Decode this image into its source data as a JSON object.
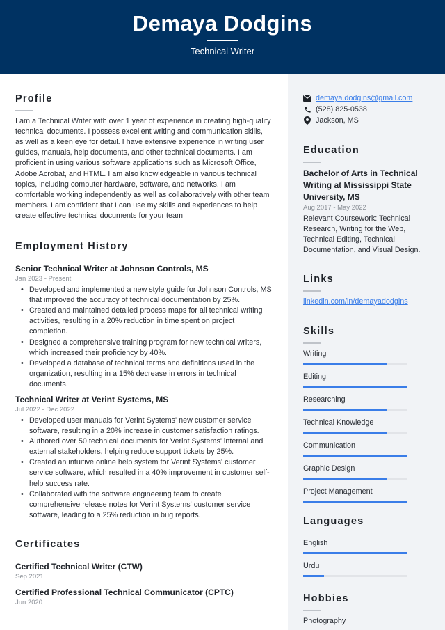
{
  "header": {
    "name": "Demaya Dodgins",
    "title": "Technical Writer"
  },
  "profile": {
    "heading": "Profile",
    "text": "I am a Technical Writer with over 1 year of experience in creating high-quality technical documents. I possess excellent writing and communication skills, as well as a keen eye for detail. I have extensive experience in writing user guides, manuals, help documents, and other technical documents. I am proficient in using various software applications such as Microsoft Office, Adobe Acrobat, and HTML. I am also knowledgeable in various technical topics, including computer hardware, software, and networks. I am comfortable working independently as well as collaboratively with other team members. I am confident that I can use my skills and experiences to help create effective technical documents for your team."
  },
  "employment": {
    "heading": "Employment History",
    "jobs": [
      {
        "title": "Senior Technical Writer at Johnson Controls, MS",
        "dates": "Jan 2023 - Present",
        "bullets": [
          "Developed and implemented a new style guide for Johnson Controls, MS that improved the accuracy of technical documentation by 25%.",
          "Created and maintained detailed process maps for all technical writing activities, resulting in a 20% reduction in time spent on project completion.",
          "Designed a comprehensive training program for new technical writers, which increased their proficiency by 40%.",
          "Developed a database of technical terms and definitions used in the organization, resulting in a 15% decrease in errors in technical documents."
        ]
      },
      {
        "title": "Technical Writer at Verint Systems, MS",
        "dates": "Jul 2022 - Dec 2022",
        "bullets": [
          "Developed user manuals for Verint Systems' new customer service software, resulting in a 20% increase in customer satisfaction ratings.",
          "Authored over 50 technical documents for Verint Systems' internal and external stakeholders, helping reduce support tickets by 25%.",
          "Created an intuitive online help system for Verint Systems' customer service software, which resulted in a 40% improvement in customer self-help success rate.",
          "Collaborated with the software engineering team to create comprehensive release notes for Verint Systems' customer service software, leading to a 25% reduction in bug reports."
        ]
      }
    ]
  },
  "certificates": {
    "heading": "Certificates",
    "items": [
      {
        "name": "Certified Technical Writer (CTW)",
        "date": "Sep 2021"
      },
      {
        "name": "Certified Professional Technical Communicator (CPTC)",
        "date": "Jun 2020"
      }
    ]
  },
  "contact": {
    "email": "demaya.dodgins@gmail.com",
    "phone": "(528) 825-0538",
    "location": "Jackson, MS",
    "icons": [
      "envelope-icon",
      "phone-icon",
      "map-pin-icon"
    ]
  },
  "education": {
    "heading": "Education",
    "degree": "Bachelor of Arts in Technical Writing at Mississippi State University, MS",
    "dates": "Aug 2017 - May 2022",
    "details": "Relevant Coursework: Technical Research, Writing for the Web, Technical Editing, Technical Documentation, and Visual Design."
  },
  "links": {
    "heading": "Links",
    "items": [
      "linkedin.com/in/demayadodgins"
    ]
  },
  "skills": {
    "heading": "Skills",
    "items": [
      {
        "label": "Writing",
        "level": 0.8
      },
      {
        "label": "Editing",
        "level": 1.0
      },
      {
        "label": "Researching",
        "level": 0.8
      },
      {
        "label": "Technical Knowledge",
        "level": 0.8
      },
      {
        "label": "Communication",
        "level": 1.0
      },
      {
        "label": "Graphic Design",
        "level": 0.8
      },
      {
        "label": "Project Management",
        "level": 1.0
      }
    ]
  },
  "languages": {
    "heading": "Languages",
    "items": [
      {
        "label": "English",
        "level": 1.0
      },
      {
        "label": "Urdu",
        "level": 0.2
      }
    ]
  },
  "hobbies": {
    "heading": "Hobbies",
    "items": [
      "Photography"
    ]
  },
  "colors": {
    "header_bg": "#003262",
    "accent": "#3a7de8",
    "sidebar_bg": "#f1f3f6"
  }
}
